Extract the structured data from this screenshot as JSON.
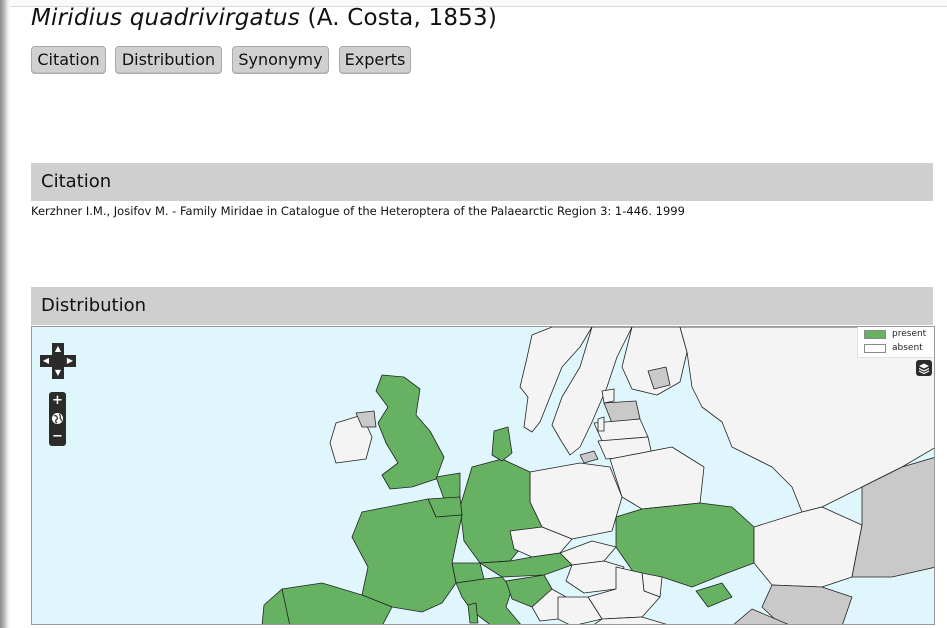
{
  "species": {
    "name": "Miridius quadrivirgatus",
    "authority": "(A. Costa, 1853)"
  },
  "tabs": [
    {
      "label": "Citation"
    },
    {
      "label": "Distribution"
    },
    {
      "label": "Synonymy"
    },
    {
      "label": "Experts"
    }
  ],
  "citation": {
    "heading": "Citation",
    "text": "Kerzhner I.M., Josifov M. - Family Miridae in Catalogue of the Heteroptera of the Palaearctic Region 3: 1-446. 1999"
  },
  "distribution": {
    "heading": "Distribution",
    "legend": [
      {
        "label": "present",
        "color": "#66b262"
      },
      {
        "label": "absent",
        "color": "#ffffff"
      }
    ],
    "colors": {
      "present": "#66b262",
      "absent": "#f4f4f4",
      "no_data": "#c9c9c9",
      "sea": "#dff7fc"
    },
    "controls": {
      "pan": {
        "up": "▲",
        "down": "▼",
        "left": "◀",
        "right": "▶"
      },
      "zoom_in": "+",
      "zoom_out": "−",
      "world_icon": "globe-icon",
      "layers_icon": "layers-icon"
    }
  }
}
